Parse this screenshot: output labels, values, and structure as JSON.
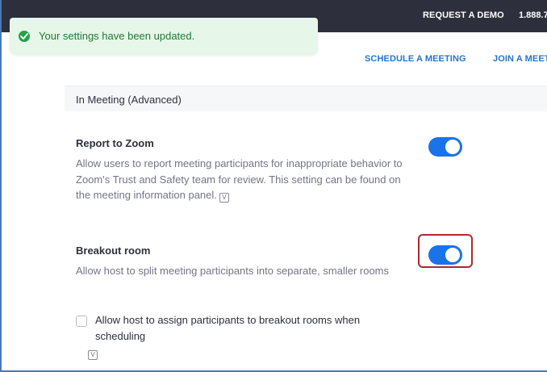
{
  "topbar": {
    "request_demo": "REQUEST A DEMO",
    "phone": "1.888.7"
  },
  "toast": {
    "message": "Your settings have been updated.",
    "icon": "check-circle-icon",
    "color": "#23a347"
  },
  "nav": {
    "schedule": "SCHEDULE A MEETING",
    "join": "JOIN A MEET"
  },
  "section": {
    "title": "In Meeting (Advanced)"
  },
  "settings": [
    {
      "title": "Report to Zoom",
      "description": "Allow users to report meeting participants for inappropriate behavior to Zoom's Trust and Safety team for review. This setting can be found on the meeting information panel.",
      "enabled": true
    },
    {
      "title": "Breakout room",
      "description": "Allow host to split meeting participants into separate, smaller rooms",
      "enabled": true,
      "sub_option": {
        "label": "Allow host to assign participants to breakout rooms when scheduling",
        "checked": false
      }
    }
  ],
  "icons": {
    "verified": "V"
  },
  "colors": {
    "toggle_on": "#1a73e8",
    "highlight": "#b0282f",
    "topbar": "#2d2f3c",
    "link": "#2a73c8"
  }
}
